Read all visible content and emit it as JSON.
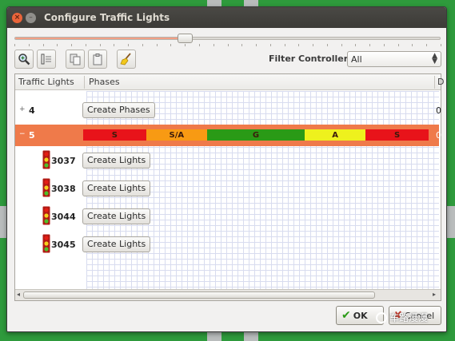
{
  "window": {
    "title": "Configure Traffic Lights"
  },
  "slider": {
    "value_fraction": 0.4
  },
  "toolbar": {
    "buttons": [
      "zoom-icon",
      "list-icon",
      "copy-icon",
      "paste-icon",
      "broom-icon"
    ],
    "filter_label": "Filter Controllers",
    "filter_value": "All"
  },
  "tree": {
    "col_traffic_lights": "Traffic Lights",
    "col_phases": "Phases",
    "col_extra": "D",
    "rows": [
      {
        "expander": "+",
        "id": "4",
        "button": "Create Phases",
        "right": "0"
      },
      {
        "expander": "−",
        "id": "5",
        "right": "0",
        "phases": [
          {
            "label": "S",
            "color": "#e8131a",
            "fraction": 0.182
          },
          {
            "label": "S/A",
            "color": "#f89a13",
            "fraction": 0.177
          },
          {
            "label": "G",
            "color": "#2a9a16",
            "fraction": 0.282
          },
          {
            "label": "A",
            "color": "#eef11d",
            "fraction": 0.177
          },
          {
            "label": "S",
            "color": "#e8131a",
            "fraction": 0.182
          }
        ]
      },
      {
        "id": "3037",
        "button": "Create Lights"
      },
      {
        "id": "3038",
        "button": "Create Lights"
      },
      {
        "id": "3044",
        "button": "Create Lights"
      },
      {
        "id": "3045",
        "button": "Create Lights"
      }
    ]
  },
  "footer": {
    "ok_label": "OK",
    "cancel_label": "Cancel"
  },
  "watermark": "车路漫漫",
  "colors": {
    "selected_row": "#ef7a4a",
    "accent_green": "#2e9a3c"
  }
}
